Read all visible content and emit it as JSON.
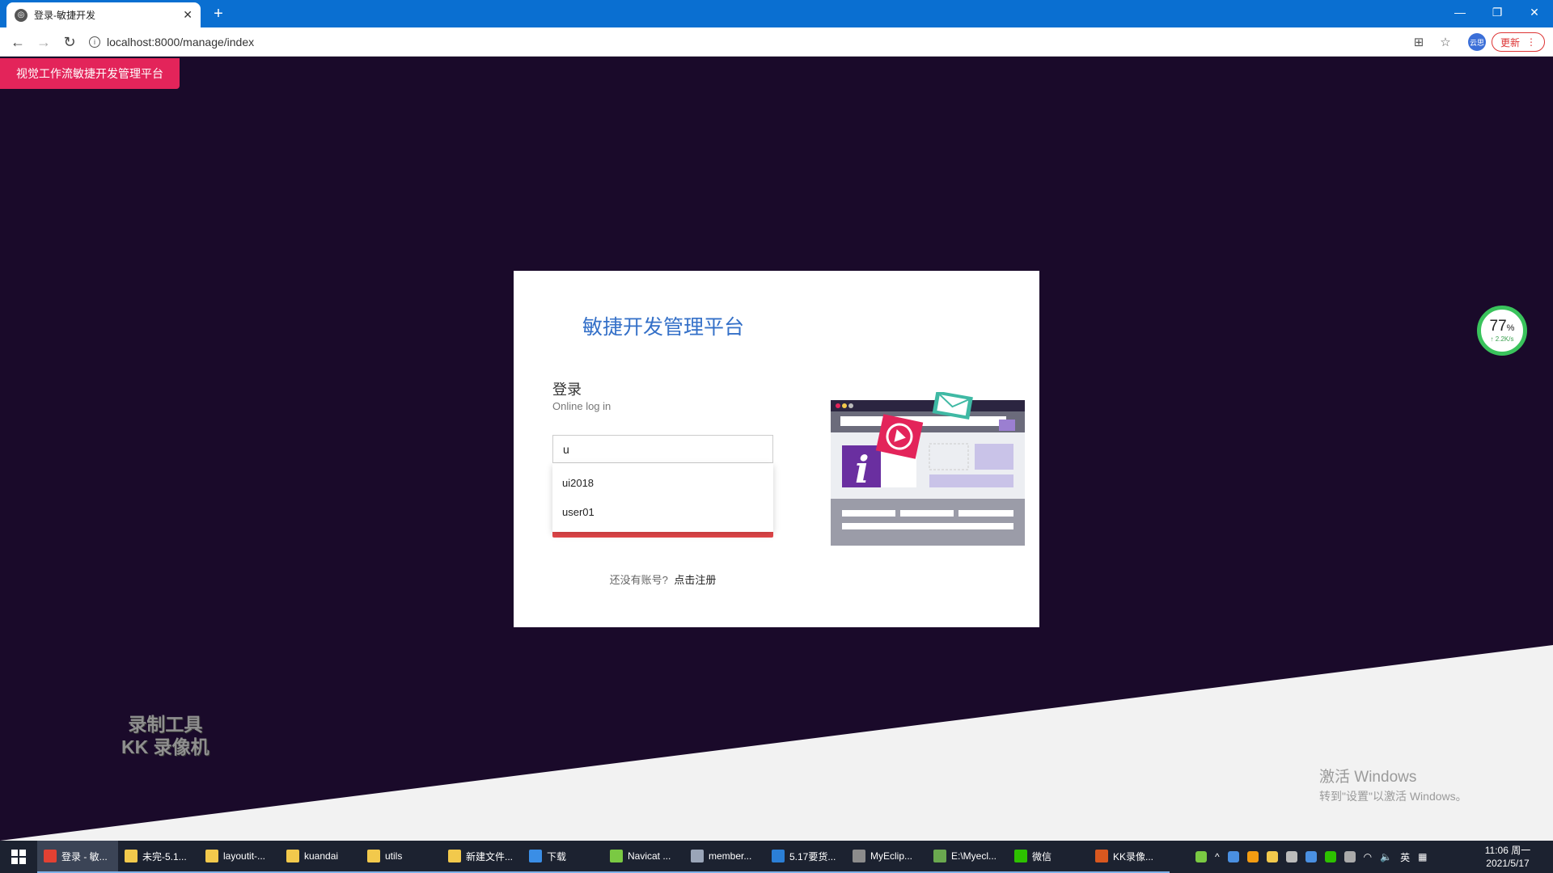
{
  "browser": {
    "tab_title": "登录-敏捷开发",
    "tab_close": "✕",
    "new_tab": "+",
    "url": "localhost:8000/manage/index",
    "update_label": "更新",
    "profile_initials": "云思"
  },
  "page": {
    "brand_badge": "视觉工作流敏捷开发管理平台",
    "card": {
      "heading": "敏捷开发管理平台",
      "login_title": "登录",
      "login_subtitle": "Online log in",
      "username_value": "u",
      "suggestions": [
        "ui2018",
        "user01"
      ],
      "register_prompt": "还没有账号?",
      "register_link": "点击注册"
    },
    "speed_widget": {
      "percent": "77",
      "percent_unit": "%",
      "rate": "↑ 2.2K/s"
    },
    "watermark": {
      "line1": "录制工具",
      "line2": "KK 录像机"
    },
    "activation": {
      "line1": "激活 Windows",
      "line2": "转到\"设置\"以激活 Windows。"
    }
  },
  "taskbar": {
    "items": [
      {
        "label": "登录 - 敏...",
        "icon": "chrome-icon",
        "color": "#e34133"
      },
      {
        "label": "未完-5.1...",
        "icon": "folder-icon",
        "color": "#f2c94c"
      },
      {
        "label": "layoutit-...",
        "icon": "folder-icon",
        "color": "#f2c94c"
      },
      {
        "label": "kuandai",
        "icon": "folder-icon",
        "color": "#f2c94c"
      },
      {
        "label": "utils",
        "icon": "folder-icon",
        "color": "#f2c94c"
      },
      {
        "label": "新建文件...",
        "icon": "folder-icon",
        "color": "#f2c94c"
      },
      {
        "label": "下载",
        "icon": "download-icon",
        "color": "#3a8ee6"
      },
      {
        "label": "Navicat ...",
        "icon": "navicat-icon",
        "color": "#7ac943"
      },
      {
        "label": "member...",
        "icon": "table-icon",
        "color": "#9aa5b8"
      },
      {
        "label": "5.17要货...",
        "icon": "vs-icon",
        "color": "#2b7fd6"
      },
      {
        "label": "MyEclip...",
        "icon": "eclipse-icon",
        "color": "#8c8c8c"
      },
      {
        "label": "E:\\Myecl...",
        "icon": "file-icon",
        "color": "#6aa84f"
      },
      {
        "label": "微信",
        "icon": "wechat-icon",
        "color": "#2dc100"
      },
      {
        "label": "KK录像...",
        "icon": "kk-icon",
        "color": "#d9581f"
      }
    ],
    "ime": "英",
    "clock_time": "11:06 周一",
    "clock_date": "2021/5/17"
  }
}
